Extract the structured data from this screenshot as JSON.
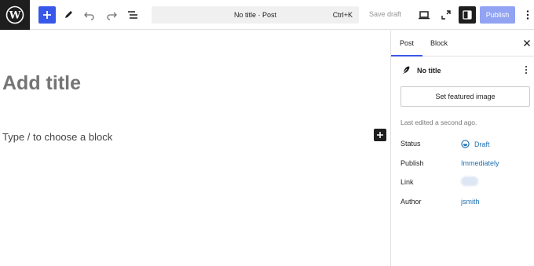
{
  "toolbar": {
    "document_title": "No title · Post",
    "shortcut": "Ctrl+K",
    "save_draft_label": "Save draft",
    "publish_label": "Publish",
    "accent_color": "#3858e9"
  },
  "editor": {
    "title_placeholder": "Add title",
    "block_placeholder": "Type / to choose a block"
  },
  "sidebar": {
    "tabs": [
      {
        "label": "Post",
        "active": true
      },
      {
        "label": "Block",
        "active": false
      }
    ],
    "post_title": "No title",
    "featured_image_label": "Set featured image",
    "last_edited": "Last edited a second ago.",
    "rows": {
      "status": {
        "label": "Status",
        "value": "Draft"
      },
      "publish": {
        "label": "Publish",
        "value": "Immediately"
      },
      "link": {
        "label": "Link"
      },
      "author": {
        "label": "Author",
        "value": "jsmith"
      }
    }
  }
}
